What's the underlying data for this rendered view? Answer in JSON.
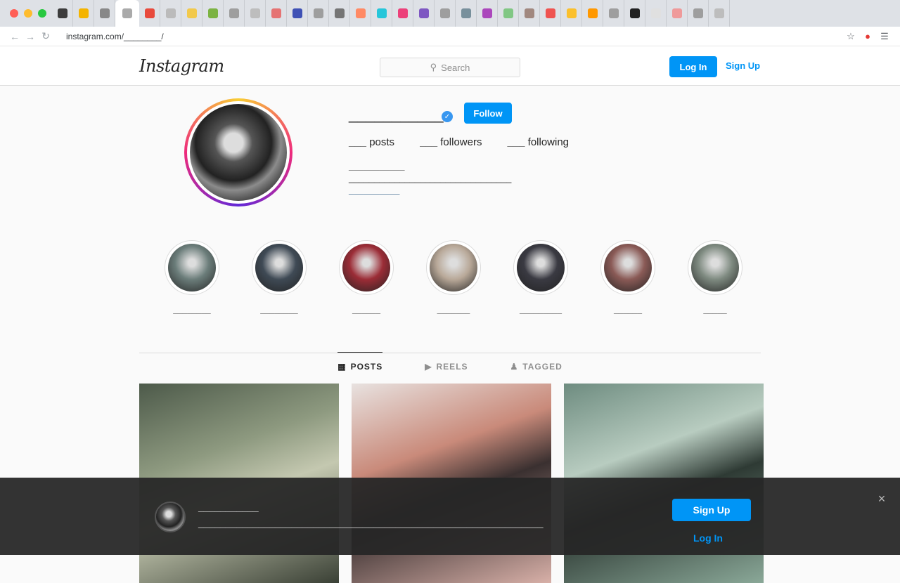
{
  "browser": {
    "window_button_colors": [
      "#ff5f57",
      "#febc2e",
      "#28c840"
    ],
    "tab_favicon_colors": [
      "#3c3c3c",
      "#f4b400",
      "#888888",
      "#aaaaaa",
      "#e84a3c",
      "#bbbbbb",
      "#f2c94c",
      "#7cb342",
      "#9e9e9e",
      "#bdbdbd",
      "#e57373",
      "#3f51b5",
      "#9e9e9e",
      "#757575",
      "#ff8a65",
      "#26c6da",
      "#ec407a",
      "#7e57c2",
      "#9e9e9e",
      "#78909c",
      "#ab47bc",
      "#81c784",
      "#a1887f",
      "#ef5350",
      "#fbc02d",
      "#ff9800",
      "#9e9e9e",
      "#212121",
      "#e0e0e0",
      "#ef9a9a",
      "#9e9e9e",
      "#bdbdbd"
    ],
    "url": "instagram.com/________/",
    "icons": [
      "back-icon",
      "forward-icon",
      "reload-icon",
      "star-icon",
      "extension-icon",
      "profile-icon"
    ]
  },
  "header": {
    "logo": "Instagram",
    "search_placeholder": "Search",
    "login_label": "Log In",
    "signup_label": "Sign Up"
  },
  "profile": {
    "username": "___________",
    "follow_label": "Follow",
    "stats": [
      {
        "value": "___",
        "label": "posts"
      },
      {
        "value": "___",
        "label": "followers"
      },
      {
        "value": "___",
        "label": "following"
      }
    ],
    "bio_name": "___________",
    "bio_line": "________________________________",
    "bio_link": "__________"
  },
  "highlights": [
    {
      "label": "________",
      "color": "#6b7d7a"
    },
    {
      "label": "________",
      "color": "#3f4a55"
    },
    {
      "label": "______",
      "color": "#9b2c36"
    },
    {
      "label": "_______",
      "color": "#b8a898"
    },
    {
      "label": "_________",
      "color": "#3a3a42"
    },
    {
      "label": "______",
      "color": "#8a5a56"
    },
    {
      "label": "_____",
      "color": "#7e8a80"
    }
  ],
  "tabs": [
    {
      "label": "POSTS",
      "icon": "grid-icon",
      "active": true
    },
    {
      "label": "REELS",
      "icon": "reels-icon",
      "active": false
    },
    {
      "label": "TAGGED",
      "icon": "tag-icon",
      "active": false
    }
  ],
  "posts": [
    {
      "colors": [
        "#4d5a4a",
        "#8e9a80",
        "#c4c8b0",
        "#3a4035"
      ]
    },
    {
      "colors": [
        "#e8e2e0",
        "#c98a7a",
        "#3a3030",
        "#d8b0a8"
      ]
    },
    {
      "colors": [
        "#6e8c80",
        "#b8ccc0",
        "#2e3a34",
        "#8aa898"
      ]
    }
  ],
  "banner": {
    "title": "___________",
    "text": "_______________________________________________________________",
    "primary_label": "Sign Up",
    "secondary_label": "Log In",
    "close": "×"
  }
}
